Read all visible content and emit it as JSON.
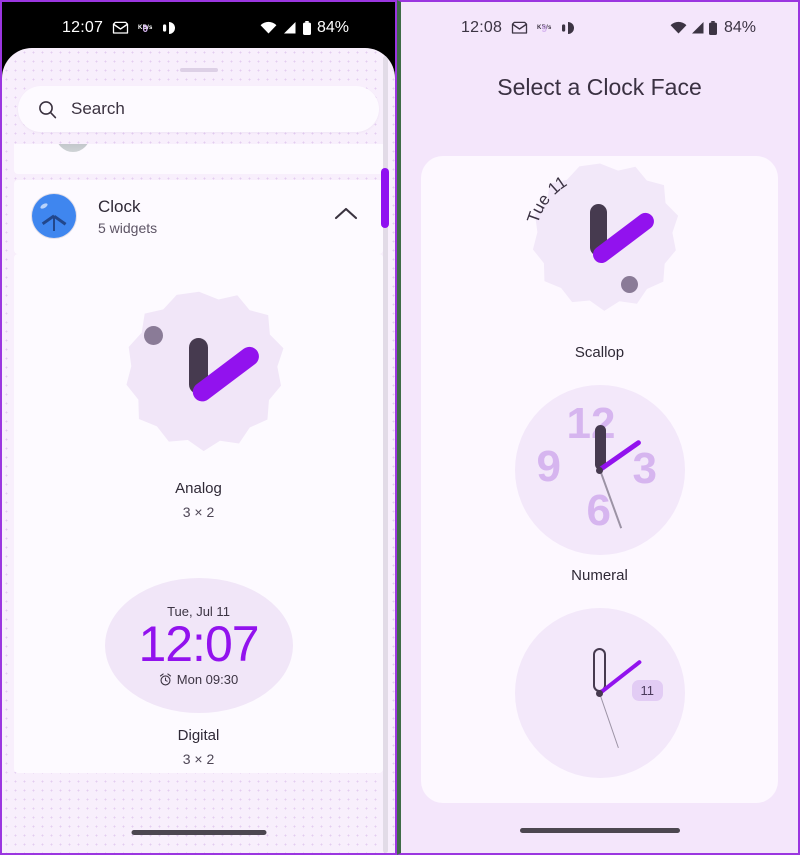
{
  "left_phone": {
    "status_bar": {
      "time": "12:07",
      "net_speed_value": "0",
      "net_speed_unit": "KB/s",
      "battery_percent": "84%",
      "icons": [
        "envelope-icon",
        "network-speed-icon",
        "do-not-disturb-icon",
        "wifi-icon",
        "signal-icon",
        "battery-icon"
      ]
    },
    "search": {
      "placeholder": "Search",
      "value": "Search"
    },
    "app_group": {
      "name": "Clock",
      "subtitle": "5 widgets",
      "collapse_state": "expanded"
    },
    "widgets": [
      {
        "label": "Analog",
        "size": "3 × 2",
        "preview_type": "scallop-analog"
      },
      {
        "label": "Digital",
        "size": "3 × 2",
        "preview_type": "digital",
        "date": "Tue, Jul 11",
        "time": "12:07",
        "alarm": "Mon 09:30"
      }
    ]
  },
  "right_phone": {
    "status_bar": {
      "time": "12:08",
      "net_speed_value": "9",
      "net_speed_unit": "KB/s",
      "battery_percent": "84%"
    },
    "title": "Select a Clock Face",
    "faces": [
      {
        "label": "Scallop",
        "date_text": "Tue 11"
      },
      {
        "label": "Numeral",
        "numerals": [
          "12",
          "3",
          "6",
          "9"
        ]
      },
      {
        "label": "",
        "date_badge": "11"
      }
    ]
  },
  "colors": {
    "accent_purple": "#9212ee",
    "hand_dark": "#463a4f",
    "background": "#f8effc",
    "card": "#fdfaff",
    "numeral": "#d6b5ef",
    "divider_green": "#3e6b47",
    "frame_purple": "#9b36e0"
  }
}
